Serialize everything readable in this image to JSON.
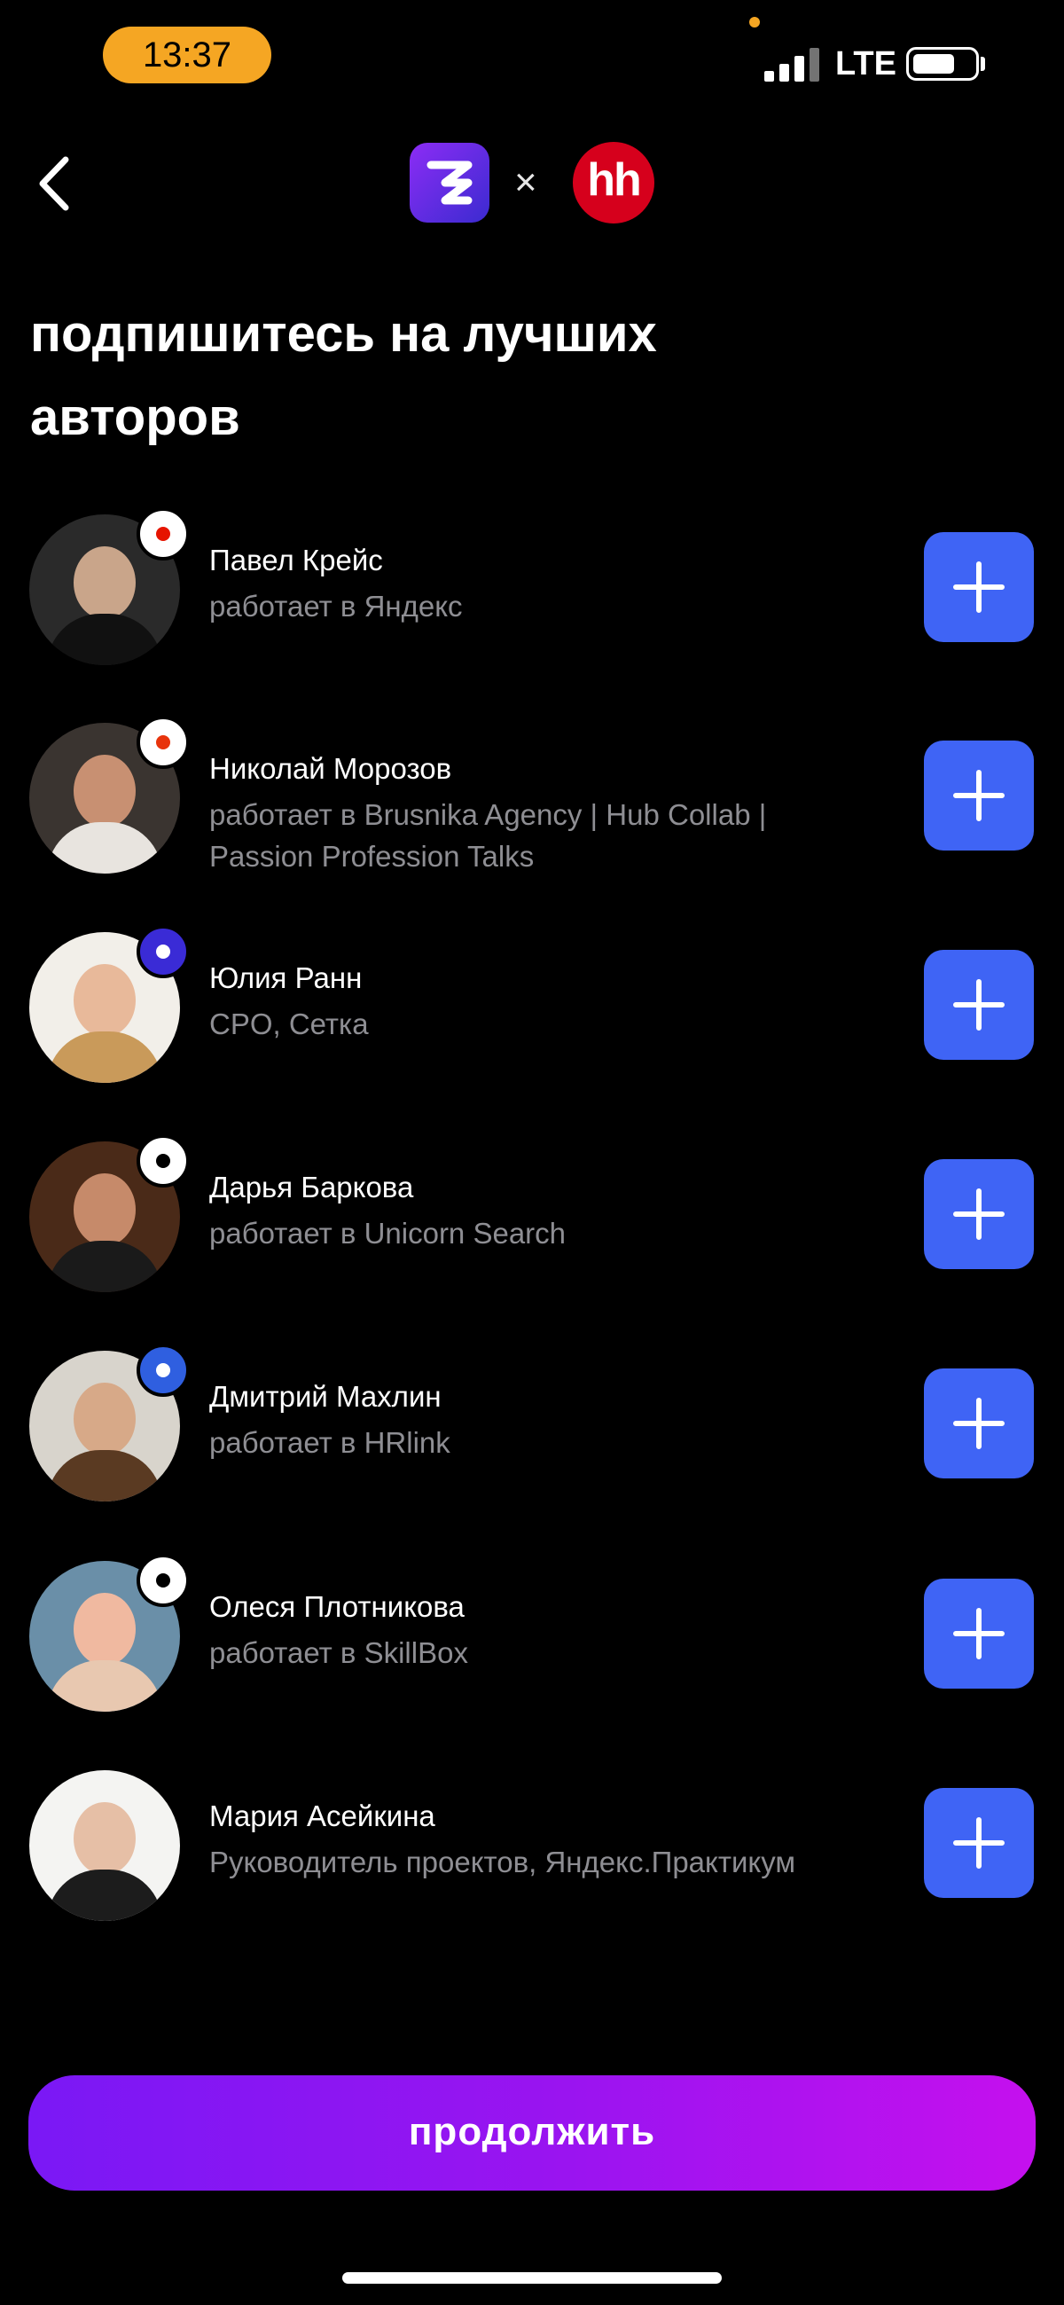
{
  "status_bar": {
    "time": "13:37",
    "network": "LTE"
  },
  "header": {
    "separator": "×",
    "partner_logo_text": "hh"
  },
  "title": "подпишитесь на лучших авторов",
  "authors": [
    {
      "name": "Павел Крейс",
      "role": "работает в Яндекс",
      "avatar_colors": [
        "#2a2a2a",
        "#c9a58a",
        "#111111"
      ],
      "badge_colors": [
        "#ffffff",
        "#e61400"
      ]
    },
    {
      "name": "Николай Морозов",
      "role": "работает в Brusnika Agency | Hub Collab | Passion Profession Talks",
      "avatar_colors": [
        "#3a3430",
        "#c89072",
        "#e8e4df"
      ],
      "badge_colors": [
        "#ffffff",
        "#e8340c"
      ]
    },
    {
      "name": "Юлия Ранн",
      "role": "CPO, Сетка",
      "avatar_colors": [
        "#f2efe9",
        "#e8b99a",
        "#c99a5a"
      ],
      "badge_colors": [
        "#3a2bd6",
        "#ffffff"
      ]
    },
    {
      "name": "Дарья Баркова",
      "role": "работает в Unicorn Search",
      "avatar_colors": [
        "#4a2a18",
        "#c68a6a",
        "#1a1a1a"
      ],
      "badge_colors": [
        "#ffffff",
        "#000000"
      ]
    },
    {
      "name": "Дмитрий Махлин",
      "role": "работает в HRlink",
      "avatar_colors": [
        "#d8d4cc",
        "#d7a988",
        "#5a3a22"
      ],
      "badge_colors": [
        "#2f5fe0",
        "#ffffff"
      ]
    },
    {
      "name": "Олеся Плотникова",
      "role": "работает в SkillBox",
      "avatar_colors": [
        "#6a8fa8",
        "#f0b9a0",
        "#e8c8b0"
      ],
      "badge_colors": [
        "#ffffff",
        "#000000"
      ]
    },
    {
      "name": "Мария Асейкина",
      "role": "Руководитель проектов, Яндекс.Практикум",
      "avatar_colors": [
        "#f4f4f2",
        "#e6bfa6",
        "#1c1c1c"
      ],
      "badge_colors": []
    }
  ],
  "continue_label": "продолжить"
}
